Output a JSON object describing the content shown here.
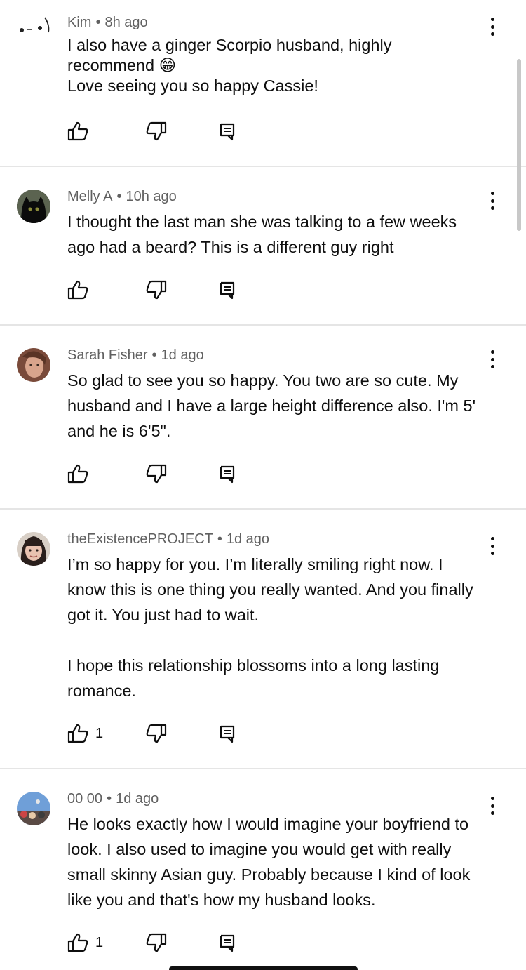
{
  "comments": [
    {
      "author": "Kim",
      "time": "8h ago",
      "lines": [
        "I also have a ginger Scorpio husband, highly",
        "recommend 😁",
        "Love seeing you so happy Cassie!"
      ],
      "likes": ""
    },
    {
      "author": "Melly A",
      "time": "10h ago",
      "lines": [
        "I thought the last man she was talking to a few weeks",
        "ago had a beard? This is a different guy right"
      ],
      "likes": ""
    },
    {
      "author": "Sarah Fisher",
      "time": "1d ago",
      "lines": [
        "So glad to see you so happy. You two are so cute. My",
        "husband and I have a large height difference also. I'm 5'",
        "and he is 6'5\"."
      ],
      "likes": ""
    },
    {
      "author": "theExistencePROJECT",
      "time": "1d ago",
      "lines": [
        "I’m so happy for you. I’m literally smiling right now. I",
        "know this is one thing you really wanted. And you finally",
        "got it. You just had to wait.",
        "I hope this relationship blossoms into a long lasting",
        "romance."
      ],
      "likes": "1"
    },
    {
      "author": "00 00",
      "time": "1d ago",
      "lines": [
        "He looks exactly how I would imagine your boyfriend to",
        "look.  I also used to imagine you would get with really",
        "small skinny Asian guy.  Probably because I kind of look",
        "like you and that's how my husband looks."
      ],
      "likes": "1"
    }
  ],
  "icons": {
    "like": "thumbs-up-icon",
    "dislike": "thumbs-down-icon",
    "reply": "reply-comment-icon",
    "menu": "more-vert-icon"
  },
  "colors": {
    "text": "#0f0f0f",
    "meta": "#606060",
    "divider": "#e5e5e5"
  }
}
